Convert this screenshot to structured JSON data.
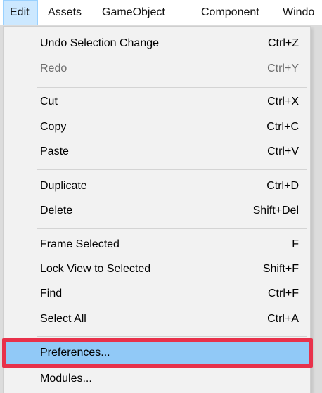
{
  "menubar": {
    "items": [
      "Edit",
      "Assets",
      "GameObject",
      "Component",
      "Windo"
    ]
  },
  "edit_menu": {
    "items": [
      {
        "label": "Undo Selection Change",
        "shortcut": "Ctrl+Z"
      },
      {
        "label": "Redo",
        "shortcut": "Ctrl+Y",
        "disabled": true
      },
      {
        "label": "Cut",
        "shortcut": "Ctrl+X"
      },
      {
        "label": "Copy",
        "shortcut": "Ctrl+C"
      },
      {
        "label": "Paste",
        "shortcut": "Ctrl+V"
      },
      {
        "label": "Duplicate",
        "shortcut": "Ctrl+D"
      },
      {
        "label": "Delete",
        "shortcut": "Shift+Del"
      },
      {
        "label": "Frame Selected",
        "shortcut": "F"
      },
      {
        "label": "Lock View to Selected",
        "shortcut": "Shift+F"
      },
      {
        "label": "Find",
        "shortcut": "Ctrl+F"
      },
      {
        "label": "Select All",
        "shortcut": "Ctrl+A"
      },
      {
        "label": "Preferences...",
        "shortcut": "",
        "highlighted": true
      },
      {
        "label": "Modules...",
        "shortcut": ""
      }
    ]
  },
  "colors": {
    "highlight_frame": "#e8314a",
    "hover_background": "#91c9f7",
    "active_menubar": "#cce8ff"
  }
}
